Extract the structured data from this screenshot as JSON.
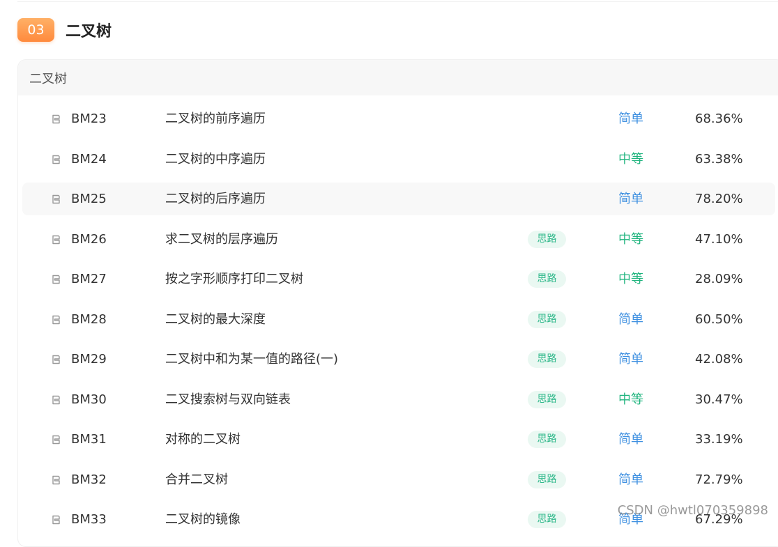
{
  "section": {
    "number": "03",
    "title": "二叉树"
  },
  "card": {
    "header": "二叉树"
  },
  "colors": {
    "easy": "#3d8fe0",
    "medium": "#1fb47e",
    "tag_bg": "#eaf8f2",
    "badge": "#ff8a3d"
  },
  "problems": [
    {
      "code": "BM23",
      "name": "二叉树的前序遍历",
      "tag": "",
      "difficulty": "简单",
      "level": "easy",
      "rate": "68.36%"
    },
    {
      "code": "BM24",
      "name": "二叉树的中序遍历",
      "tag": "",
      "difficulty": "中等",
      "level": "medium",
      "rate": "63.38%"
    },
    {
      "code": "BM25",
      "name": "二叉树的后序遍历",
      "tag": "",
      "difficulty": "简单",
      "level": "easy",
      "rate": "78.20%"
    },
    {
      "code": "BM26",
      "name": "求二叉树的层序遍历",
      "tag": "思路",
      "difficulty": "中等",
      "level": "medium",
      "rate": "47.10%"
    },
    {
      "code": "BM27",
      "name": "按之字形顺序打印二叉树",
      "tag": "思路",
      "difficulty": "中等",
      "level": "medium",
      "rate": "28.09%"
    },
    {
      "code": "BM28",
      "name": "二叉树的最大深度",
      "tag": "思路",
      "difficulty": "简单",
      "level": "easy",
      "rate": "60.50%"
    },
    {
      "code": "BM29",
      "name": "二叉树中和为某一值的路径(一)",
      "tag": "思路",
      "difficulty": "简单",
      "level": "easy",
      "rate": "42.08%"
    },
    {
      "code": "BM30",
      "name": "二叉搜索树与双向链表",
      "tag": "思路",
      "difficulty": "中等",
      "level": "medium",
      "rate": "30.47%"
    },
    {
      "code": "BM31",
      "name": "对称的二叉树",
      "tag": "思路",
      "difficulty": "简单",
      "level": "easy",
      "rate": "33.19%"
    },
    {
      "code": "BM32",
      "name": "合并二叉树",
      "tag": "思路",
      "difficulty": "简单",
      "level": "easy",
      "rate": "72.79%"
    },
    {
      "code": "BM33",
      "name": "二叉树的镜像",
      "tag": "思路",
      "difficulty": "简单",
      "level": "easy",
      "rate": "67.29%"
    }
  ],
  "watermark": "CSDN @hwtl070359898"
}
